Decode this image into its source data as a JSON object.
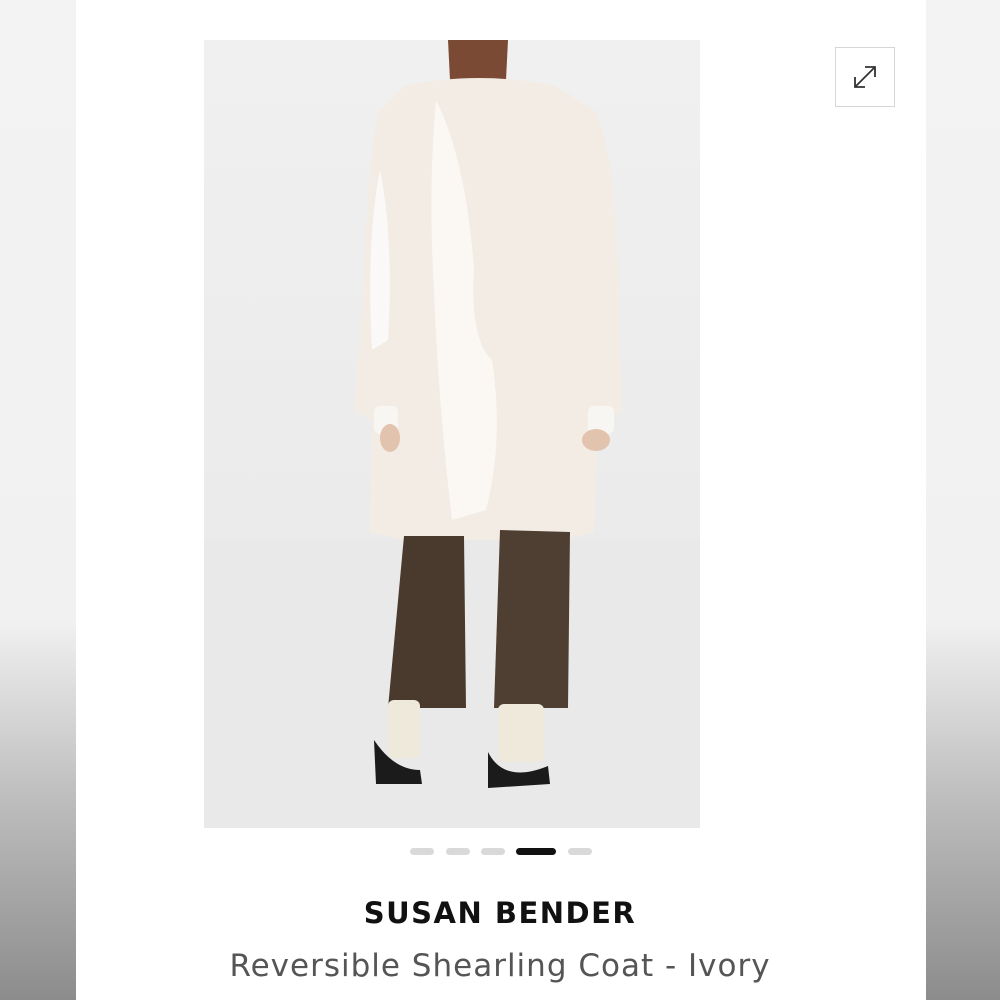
{
  "product": {
    "brand": "SUSAN BENDER",
    "title": "Reversible Shearling Coat - Ivory"
  },
  "gallery": {
    "image_count": 5,
    "active_index": 3,
    "expand_icon": "expand-diagonal-arrows-icon"
  },
  "colors": {
    "coat": "#f2ece4",
    "trousers": "#4a3a2e",
    "active_dot": "#111111",
    "inactive_dot": "#d9d9d9"
  }
}
